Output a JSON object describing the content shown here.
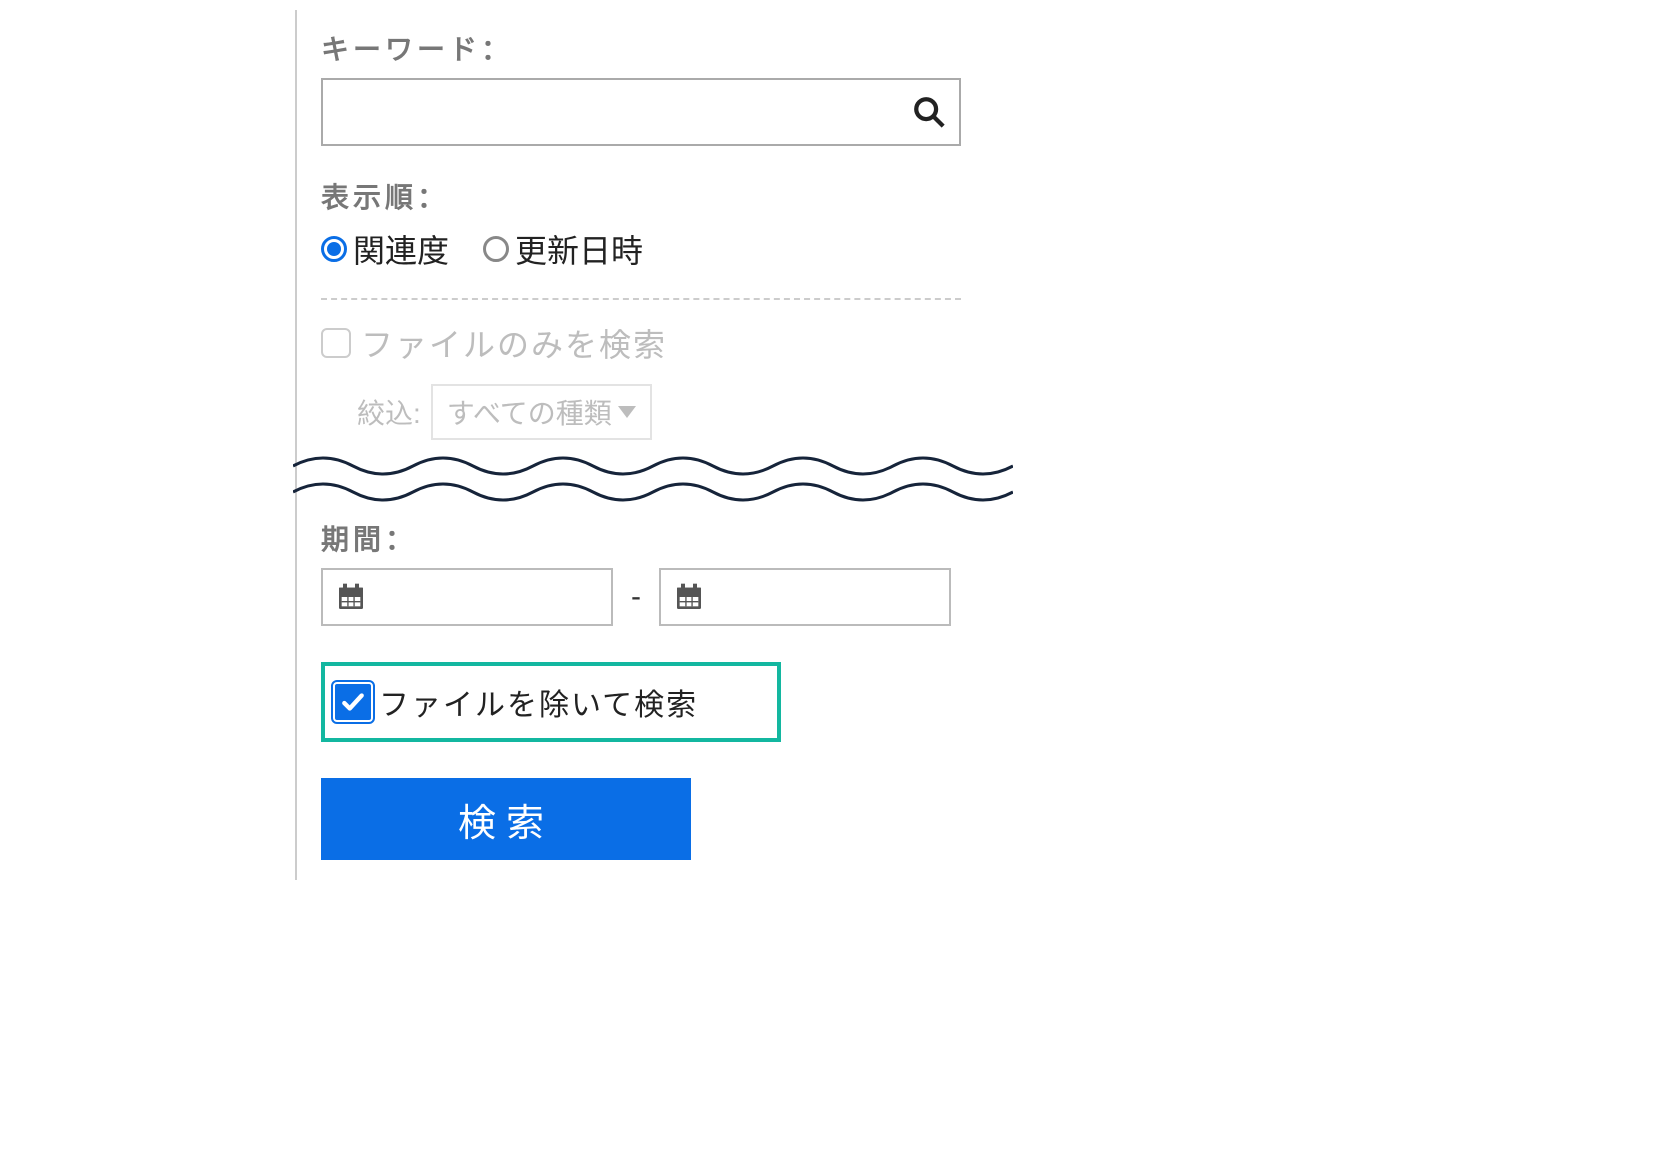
{
  "keyword": {
    "label": "キーワード：",
    "value": "",
    "placeholder": ""
  },
  "sort": {
    "label": "表示順：",
    "options": [
      {
        "label": "関連度",
        "checked": true
      },
      {
        "label": "更新日時",
        "checked": false
      }
    ]
  },
  "file_only": {
    "label": "ファイルのみを検索",
    "checked": false,
    "disabled": true
  },
  "filter": {
    "label": "絞込:",
    "selected": "すべての種類"
  },
  "period": {
    "label": "期間：",
    "from": "",
    "to": "",
    "separator": "-"
  },
  "exclude_files": {
    "label": "ファイルを除いて検索",
    "checked": true,
    "highlighted": true
  },
  "search_button": {
    "label": "検索"
  },
  "colors": {
    "accent": "#0a6ee6",
    "highlight_border": "#13b7a0"
  }
}
